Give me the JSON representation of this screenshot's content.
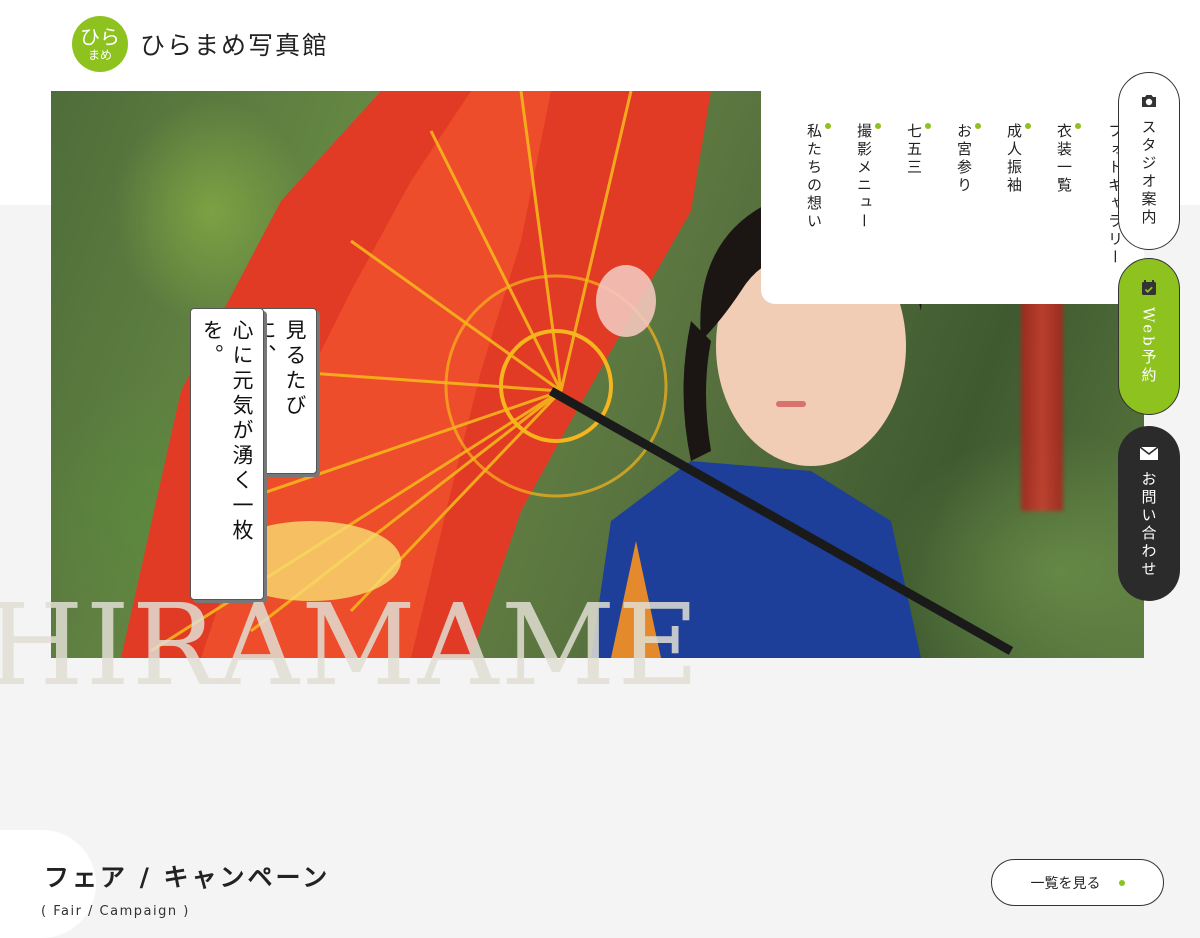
{
  "brand": {
    "logo_line1": "ひら",
    "logo_line2": "まめ",
    "name": "ひらまめ写真館",
    "accent_color": "#8dc21f"
  },
  "nav": {
    "items": [
      {
        "label": "フォトギャラリー"
      },
      {
        "label": "衣装一覧"
      },
      {
        "label": "成人振袖"
      },
      {
        "label": "お宮参り"
      },
      {
        "label": "七五三"
      },
      {
        "label": "撮影メニュー"
      },
      {
        "label": "私たちの想い"
      }
    ]
  },
  "side_buttons": {
    "studio": {
      "label": "スタジオ案内",
      "icon": "camera-icon"
    },
    "web": {
      "label": "Web予約",
      "icon": "calendar-icon"
    },
    "contact": {
      "label": "お問い合わせ",
      "icon": "mail-icon"
    }
  },
  "hero": {
    "tagline_1": "見るたびに、",
    "tagline_2": "心に元気が湧く一枚を。",
    "watermark": "HIRAMAME"
  },
  "fair": {
    "title": "フェア / キャンペーン",
    "subtitle": "( Fair / Campaign )",
    "more_label": "一覧を見る"
  }
}
